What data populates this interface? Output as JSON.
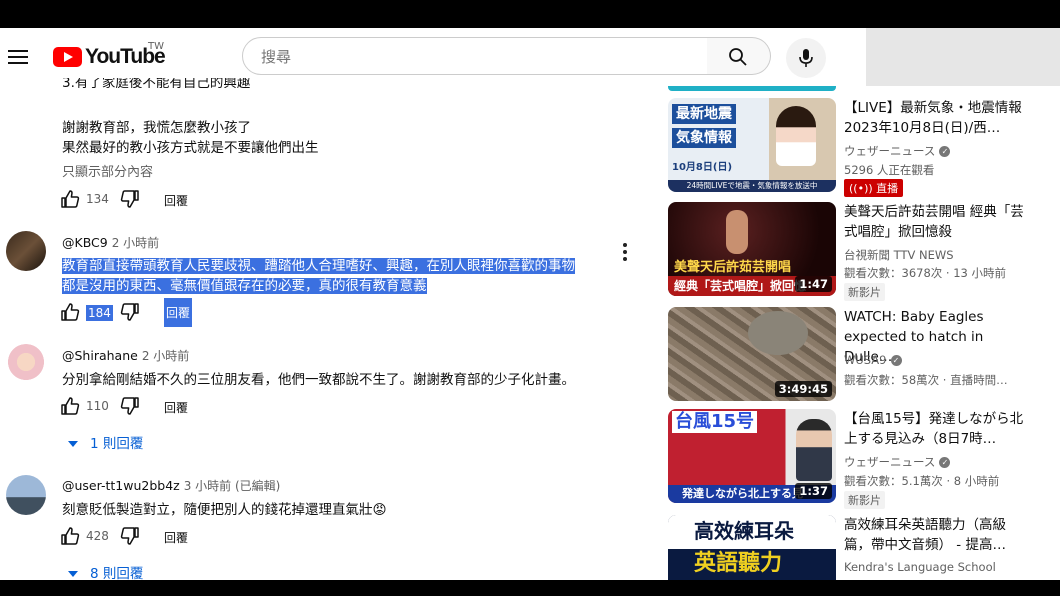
{
  "header": {
    "logo_text": "YouTube",
    "region": "TW",
    "search_placeholder": "搜尋"
  },
  "comments": {
    "prev_fragment": "3.有了家庭後不能有自己的興趣",
    "prev_line2": "謝謝教育部，我慌怎麼教小孩了",
    "prev_line3": "果然最好的教小孩方式就是不要讓他們出生",
    "prev_show_less": "只顯示部分內容",
    "prev_likes": "134",
    "reply_label": "回覆",
    "items": [
      {
        "author": "@KBC9",
        "time": "2 小時前",
        "line1": "教育部直接帶頭教育人民要歧視、蹧踏他人合理嗜好、興趣，在別人眼裡你喜歡的事物",
        "line2": "都是沒用的東西、毫無價值跟存在的必要，真的很有教育意義",
        "likes": "184",
        "reply": "回覆"
      },
      {
        "author": "@Shirahane",
        "time": "2 小時前",
        "line1": "分別拿給剛結婚不久的三位朋友看，他們一致都說不生了。謝謝教育部的少子化計畫。",
        "likes": "110",
        "reply": "回覆",
        "replies_toggle": "1 則回覆"
      },
      {
        "author": "@user-tt1wu2bb4z",
        "time": "3 小時前 (已編輯)",
        "line1": "刻意貶低製造對立，隨便把別人的錢花掉還理直氣壯😡",
        "likes": "428",
        "reply": "回覆",
        "replies_toggle": "8 則回覆"
      }
    ]
  },
  "sidebar": {
    "videos": [
      {
        "thumb_title1": "最新地震",
        "thumb_title2": "気象情報",
        "thumb_date": "10月8日(日)",
        "thumb_footer": "24時間LIVEで地震・気象情報を放送中",
        "title": "【LIVE】最新気象・地震情報 2023年10月8日(日)/西…",
        "channel": "ウェザーニュース",
        "meta": "5296 人正在觀看",
        "badge": "直播"
      },
      {
        "thumb_caption1": "美聲天后許茹芸開唱",
        "thumb_caption2": "經典「芸式唱腔」掀回憶",
        "duration": "1:47",
        "title": "美聲天后許茹芸開唱 經典「芸式唱腔」掀回憶殺",
        "channel": "台視新聞 TTV NEWS",
        "meta": "觀看次數：3678次 · 13 小時前",
        "badge": "新影片"
      },
      {
        "duration": "3:49:45",
        "title": "WATCH: Baby Eagles expected to hatch in Dulle…",
        "channel": "WUSA9",
        "meta": "觀看次數：58萬次 · 直播時間…"
      },
      {
        "thumb_title": "台風15号",
        "thumb_footer": "発達しながら北上する見",
        "duration": "1:37",
        "title": "【台風15号】発達しながら北上する見込み（8日7時…",
        "channel": "ウェザーニュース",
        "meta": "觀看次數：5.1萬次 · 8 小時前",
        "badge": "新影片"
      },
      {
        "thumb_title1": "高效練耳朵",
        "thumb_title2": "英語聽力",
        "title": "高效練耳朵英語聽力（高級篇，帶中文音頻） - 提高…",
        "channel": "Kendra's Language School"
      }
    ]
  }
}
